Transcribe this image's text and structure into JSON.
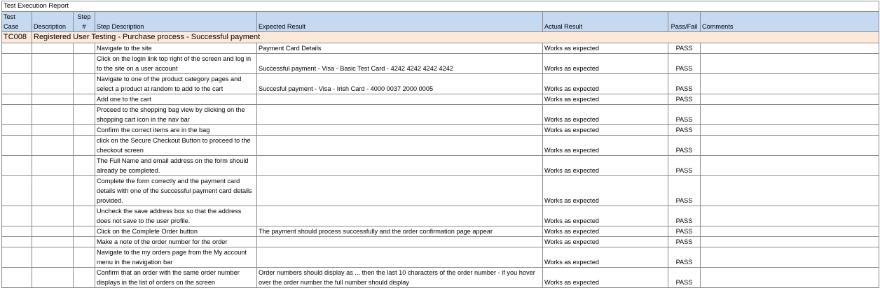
{
  "report_title": "Test Execution Report",
  "headers": {
    "test_case": "Test Case",
    "description": "Description",
    "step_no": "Step #",
    "step_description": "Step Description",
    "expected": "Expected Result",
    "actual": "Actual Result",
    "pass_fail": "Pass/Fail",
    "comments": "Comments"
  },
  "test_case": {
    "id": "TC008",
    "title": "Registered User Testing - Purchase process - Successful payment"
  },
  "steps": [
    {
      "step": "Navigate to the site",
      "expected": "Payment Card Details",
      "actual": "Works as expected",
      "result": "PASS"
    },
    {
      "step": "Click on the login link top right of the screen and log in to the site on a user account",
      "expected": "Successful payment - Visa - Basic Test Card - 4242 4242 4242 4242",
      "actual": "Works as expected",
      "result": "PASS"
    },
    {
      "step": "Navigate to one of the product category pages and select a product at random to add to the cart",
      "expected": "Succesful payment - Visa - Irish Card - 4000 0037 2000 0005",
      "actual": "Works as expected",
      "result": "PASS"
    },
    {
      "step": "Add one to the cart",
      "expected": "",
      "actual": "Works as expected",
      "result": "PASS"
    },
    {
      "step": "Proceed to the shopping bag view by clicking on the shopping cart icon in the nav bar",
      "expected": "",
      "actual": "Works as expected",
      "result": "PASS"
    },
    {
      "step": "Confirm the correct items are in the bag",
      "expected": "",
      "actual": "Works as expected",
      "result": "PASS"
    },
    {
      "step": "click on the Secure Checkout Button to proceed to the checkout screen",
      "expected": "",
      "actual": "Works as expected",
      "result": "PASS"
    },
    {
      "step": "The Full Name and email address on the form should already be completed.",
      "expected": "",
      "actual": "Works as expected",
      "result": "PASS"
    },
    {
      "step": "Complete the form correctly and the payment card details with one of the successful payment card details provided.",
      "expected": "",
      "actual": "Works as expected",
      "result": "PASS"
    },
    {
      "step": "Uncheck the save address box so that the address does not save to the user profile.",
      "expected": "",
      "actual": "Works as expected",
      "result": "PASS"
    },
    {
      "step": "Click on the Complete Order button",
      "expected": "The payment should process successfully and the order confirmation page appear",
      "actual": "Works as expected",
      "result": "PASS"
    },
    {
      "step": "Make a note of the order number for the order",
      "expected": "",
      "actual": "Works as expected",
      "result": "PASS"
    },
    {
      "step": "Navigate to the my orders page from the My account menu in the navigation bar",
      "expected": "",
      "actual": "Works as expected",
      "result": "PASS"
    },
    {
      "step": "Confirm that an order with the same order number displays in the list of orders on the screen",
      "expected": "Order numbers should display as ... then the last 10 characters of the order number - if you hover over the order number the full number should display",
      "actual": "Works as expected",
      "result": "PASS"
    }
  ]
}
